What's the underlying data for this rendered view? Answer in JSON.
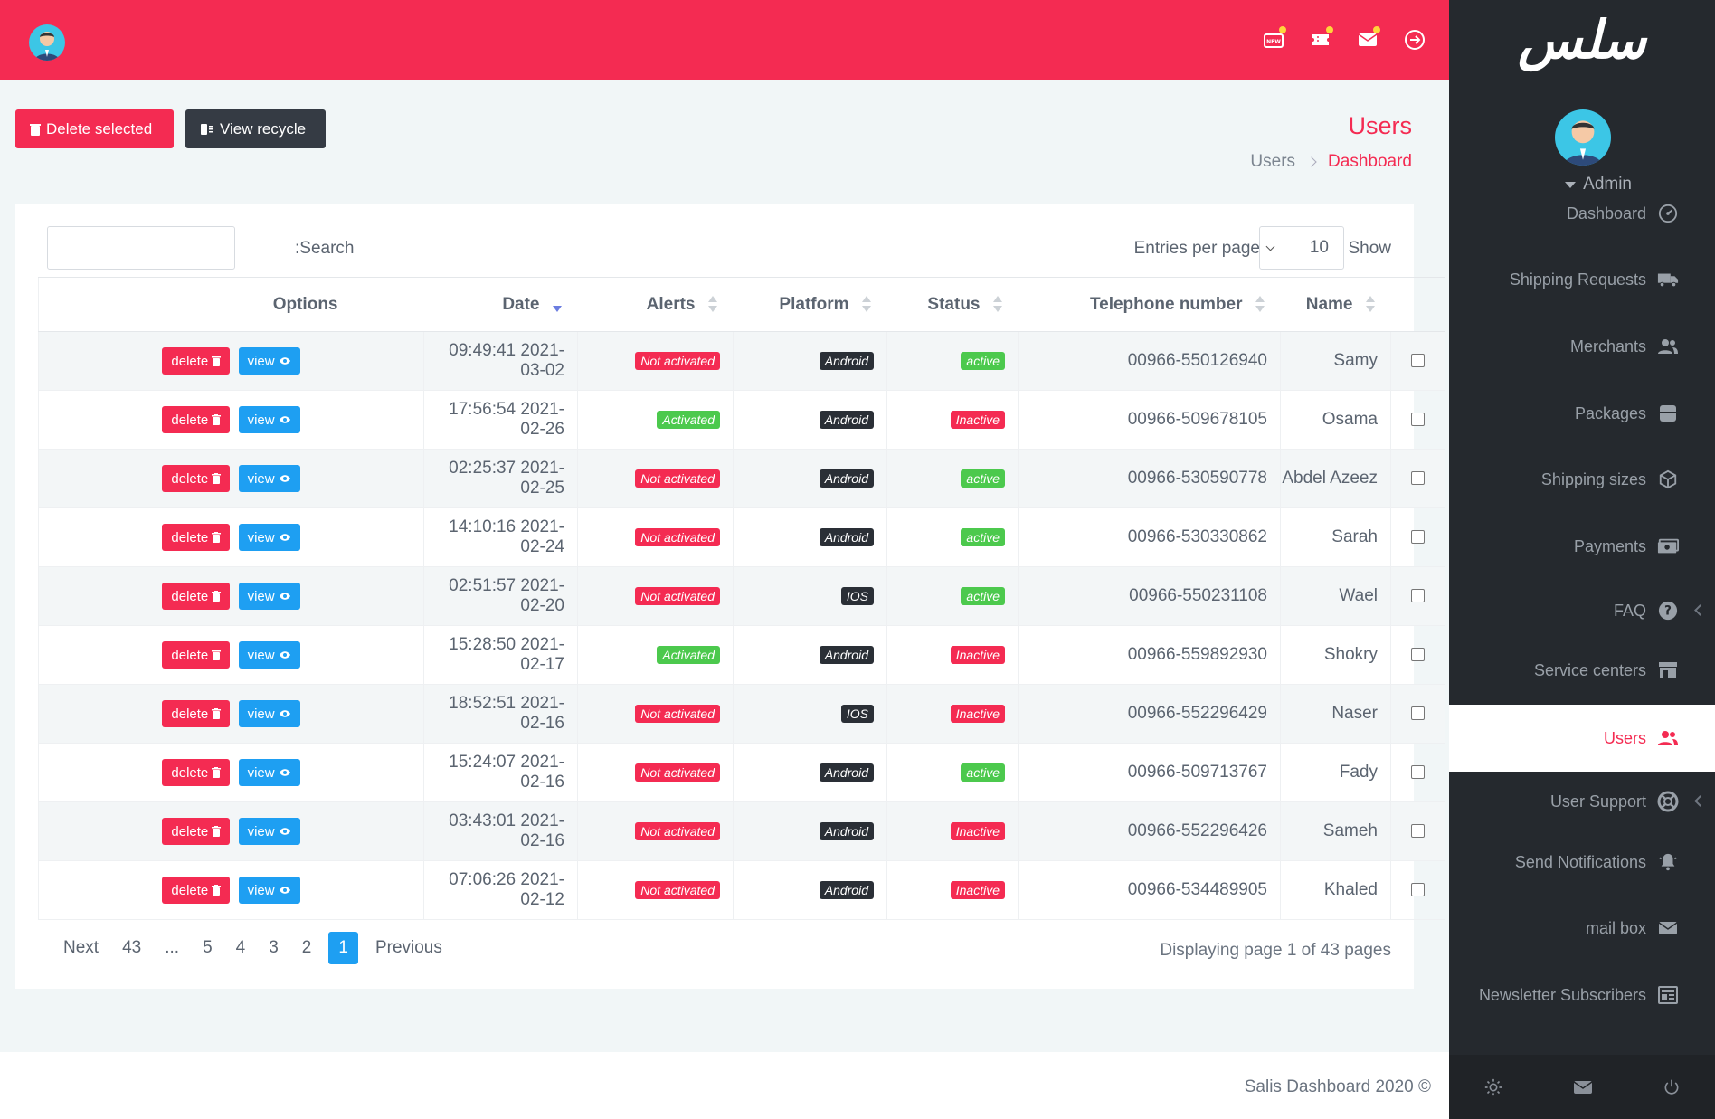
{
  "app": {
    "logo_text": "سلس",
    "footer": "Salis Dashboard 2020 ©"
  },
  "user": {
    "name": "Admin"
  },
  "header": {
    "icons": [
      "new-badge-icon",
      "ticket-icon",
      "mail-icon",
      "logout-icon"
    ]
  },
  "toolbar": {
    "delete_selected": "Delete selected",
    "view_recycle": "View recycle"
  },
  "page": {
    "title": "Users",
    "breadcrumb": [
      "Users",
      "Dashboard"
    ]
  },
  "table_controls": {
    "search_label": ":Search",
    "search_value": "",
    "entries_label": "Entries per page",
    "entries_value": "10",
    "show_label": "Show"
  },
  "columns": [
    "Options",
    "Date",
    "Alerts",
    "Platform",
    "Status",
    "Telephone number",
    "Name"
  ],
  "row_buttons": {
    "delete": "delete",
    "view": "view"
  },
  "rows": [
    {
      "date": "09:49:41 2021-03-02",
      "alert": "Not activated",
      "platform": "Android",
      "status": "active",
      "phone": "00966-550126940",
      "name": "Samy"
    },
    {
      "date": "17:56:54 2021-02-26",
      "alert": "Activated",
      "platform": "Android",
      "status": "Inactive",
      "phone": "00966-509678105",
      "name": "Osama"
    },
    {
      "date": "02:25:37 2021-02-25",
      "alert": "Not activated",
      "platform": "Android",
      "status": "active",
      "phone": "00966-530590778",
      "name": "Abdel Azeez"
    },
    {
      "date": "14:10:16 2021-02-24",
      "alert": "Not activated",
      "platform": "Android",
      "status": "active",
      "phone": "00966-530330862",
      "name": "Sarah"
    },
    {
      "date": "02:51:57 2021-02-20",
      "alert": "Not activated",
      "platform": "IOS",
      "status": "active",
      "phone": "00966-550231108",
      "name": "Wael"
    },
    {
      "date": "15:28:50 2021-02-17",
      "alert": "Activated",
      "platform": "Android",
      "status": "Inactive",
      "phone": "00966-559892930",
      "name": "Shokry"
    },
    {
      "date": "18:52:51 2021-02-16",
      "alert": "Not activated",
      "platform": "IOS",
      "status": "Inactive",
      "phone": "00966-552296429",
      "name": "Naser"
    },
    {
      "date": "15:24:07 2021-02-16",
      "alert": "Not activated",
      "platform": "Android",
      "status": "active",
      "phone": "00966-509713767",
      "name": "Fady"
    },
    {
      "date": "03:43:01 2021-02-16",
      "alert": "Not activated",
      "platform": "Android",
      "status": "Inactive",
      "phone": "00966-552296426",
      "name": "Sameh"
    },
    {
      "date": "07:06:26 2021-02-12",
      "alert": "Not activated",
      "platform": "Android",
      "status": "Inactive",
      "phone": "00966-534489905",
      "name": "Khaled"
    }
  ],
  "pagination": {
    "items": [
      "Next",
      "43",
      "...",
      "5",
      "4",
      "3",
      "2",
      "1",
      "Previous"
    ],
    "current": "1",
    "info": "Displaying page 1 of 43 pages"
  },
  "sidebar": {
    "items": [
      {
        "label": "Dashboard",
        "icon": "gauge-icon",
        "active": false,
        "chevron": false
      },
      {
        "label": "Shipping Requests",
        "icon": "truck-icon",
        "active": false,
        "chevron": false
      },
      {
        "label": "Merchants",
        "icon": "users-icon",
        "active": false,
        "chevron": false
      },
      {
        "label": "Packages",
        "icon": "package-icon",
        "active": false,
        "chevron": false
      },
      {
        "label": "Shipping sizes",
        "icon": "cube-icon",
        "active": false,
        "chevron": false
      },
      {
        "label": "Payments",
        "icon": "money-icon",
        "active": false,
        "chevron": false
      },
      {
        "label": "FAQ",
        "icon": "question-icon",
        "active": false,
        "chevron": true
      },
      {
        "label": "Service centers",
        "icon": "store-icon",
        "active": false,
        "chevron": false
      },
      {
        "label": "Users",
        "icon": "users-icon",
        "active": true,
        "chevron": false
      },
      {
        "label": "User Support",
        "icon": "lifebuoy-icon",
        "active": false,
        "chevron": true
      },
      {
        "label": "Send Notifications",
        "icon": "bell-icon",
        "active": false,
        "chevron": false
      },
      {
        "label": "mail box",
        "icon": "envelope-icon",
        "active": false,
        "chevron": false
      },
      {
        "label": "Newsletter Subscribers",
        "icon": "newspaper-icon",
        "active": false,
        "chevron": false
      }
    ],
    "bottom_icons": [
      "settings-icon",
      "mail-icon",
      "power-icon"
    ]
  },
  "colors": {
    "accent": "#f42b52",
    "sidebar": "#25292e",
    "view": "#1e9ff2",
    "success": "#4cc94d"
  }
}
